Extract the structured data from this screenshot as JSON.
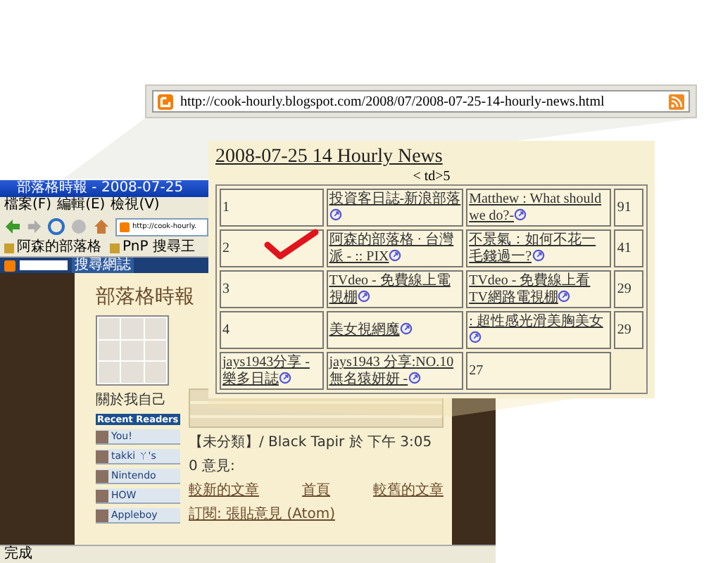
{
  "browser": {
    "title": "部落格時報 - 2008-07-25",
    "menu": [
      "檔案(F)",
      "編輯(E)",
      "檢視(V)"
    ],
    "address": "http://cook-hourly.",
    "bookmarks": [
      "阿森的部落格",
      "PnP 搜尋王"
    ],
    "blogger_button": "搜尋網誌",
    "status": "完成"
  },
  "blog": {
    "title": "部落格時報",
    "about_heading": "關於我自己",
    "readers_heading": "Recent Readers",
    "readers": [
      "You!",
      "takki ㄚ's",
      "Nintendo",
      "HOW",
      "Appleboy"
    ],
    "post_footer": "【未分類】/ Black Tapir 於 下午 3:05",
    "comments": "0 意見:",
    "nav": [
      "較新的文章",
      "首頁",
      "較舊的文章"
    ],
    "subscribe": "訂閱: 張貼意見 (Atom)"
  },
  "callout_url": {
    "address": "http://cook-hourly.blogspot.com/2008/07/2008-07-25-14-hourly-news.html"
  },
  "callout_post": {
    "title": "2008-07-25 14 Hourly News",
    "subtitle": "< td>5",
    "rows": [
      {
        "marked": false,
        "cells": [
          {
            "kind": "text",
            "text": "1"
          },
          {
            "kind": "link",
            "text": "投資客日誌-新浪部落"
          },
          {
            "kind": "link",
            "text": "Matthew : What should we do?-"
          },
          {
            "kind": "text",
            "text": "91"
          }
        ]
      },
      {
        "marked": true,
        "cells": [
          {
            "kind": "text",
            "text": "2"
          },
          {
            "kind": "link",
            "text": "阿森的部落格 · 台灣派 - :: PIX"
          },
          {
            "kind": "link",
            "text": "不景氣：如何不花一毛錢過一?"
          },
          {
            "kind": "text",
            "text": "41"
          }
        ]
      },
      {
        "marked": false,
        "cells": [
          {
            "kind": "text",
            "text": "3"
          },
          {
            "kind": "link",
            "text": "TVdeo - 免費線上電視棚"
          },
          {
            "kind": "link",
            "text": "TVdeo - 免費線上看TV網路電視棚"
          },
          {
            "kind": "text",
            "text": "29"
          }
        ]
      },
      {
        "marked": false,
        "cells": [
          {
            "kind": "text",
            "text": "4"
          },
          {
            "kind": "link",
            "text": "美女視網魔"
          },
          {
            "kind": "link",
            "text": ": 超性感光滑美胸美女"
          },
          {
            "kind": "text",
            "text": "29"
          }
        ]
      },
      {
        "marked": false,
        "cells": [
          {
            "kind": "link",
            "text": "jays1943分享 - 樂多日誌"
          },
          {
            "kind": "link",
            "text": "jays1943 分享:NO.10 無名猿妍妍 -"
          },
          {
            "kind": "text",
            "text": "27"
          }
        ]
      }
    ]
  }
}
